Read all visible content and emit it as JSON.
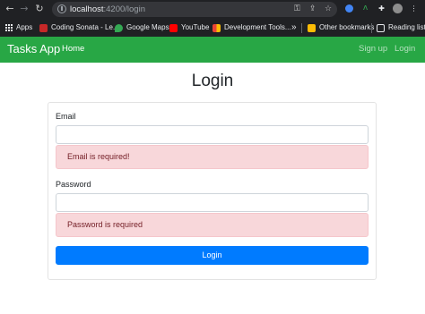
{
  "browser": {
    "url_host": "localhost",
    "url_path": ":4200/login",
    "bookmarks": [
      {
        "label": "Apps",
        "color": "#e8eaed"
      },
      {
        "label": "Coding Sonata - Le...",
        "color": "#c62828"
      },
      {
        "label": "Google Maps",
        "color": "#34a853"
      },
      {
        "label": "YouTube",
        "color": "#ff0000"
      },
      {
        "label": "Development Tools...",
        "color": "#fbbc05"
      }
    ],
    "overflow_label": "»",
    "other_bookmarks": "Other bookmarks",
    "reading_list": "Reading list"
  },
  "navbar": {
    "brand": "Tasks App",
    "home": "Home",
    "signup": "Sign up",
    "login": "Login",
    "color": "#28a745"
  },
  "page": {
    "title": "Login"
  },
  "form": {
    "email_label": "Email",
    "email_value": "",
    "email_error": "Email is required!",
    "password_label": "Password",
    "password_value": "",
    "password_error": "Password is required",
    "submit_label": "Login"
  }
}
